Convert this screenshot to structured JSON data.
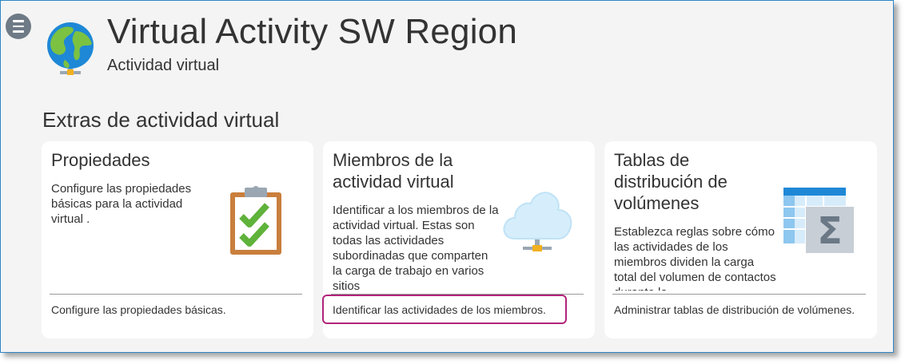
{
  "header": {
    "title": "Virtual Activity SW Region",
    "subtitle": "Actividad virtual"
  },
  "section": {
    "title": "Extras de actividad virtual"
  },
  "cards": [
    {
      "title": "Propiedades",
      "description": "Configure las propiedades básicas para la actividad virtual .",
      "link": "Configure las propiedades básicas.",
      "icon": "clipboard-check-icon"
    },
    {
      "title": "Miembros de la actividad virtual",
      "description": "Identificar a los miembros de la actividad virtual. Estas son todas las actividades subordinadas que comparten la carga de trabajo en varios sitios",
      "link": "Identificar las actividades de los miembros.",
      "icon": "cloud-network-icon"
    },
    {
      "title": "Tablas de distribución de volúmenes",
      "description": "Establezca reglas sobre cómo las actividades de los miembros dividen la carga total del volumen de contactos durante la",
      "link": "Administrar tablas de distribución de volúmenes.",
      "icon": "table-sigma-icon"
    }
  ],
  "colors": {
    "frame_border": "#2e86c9",
    "highlight": "#b0247a",
    "background": "#f4f4f4",
    "card": "#ffffff"
  }
}
